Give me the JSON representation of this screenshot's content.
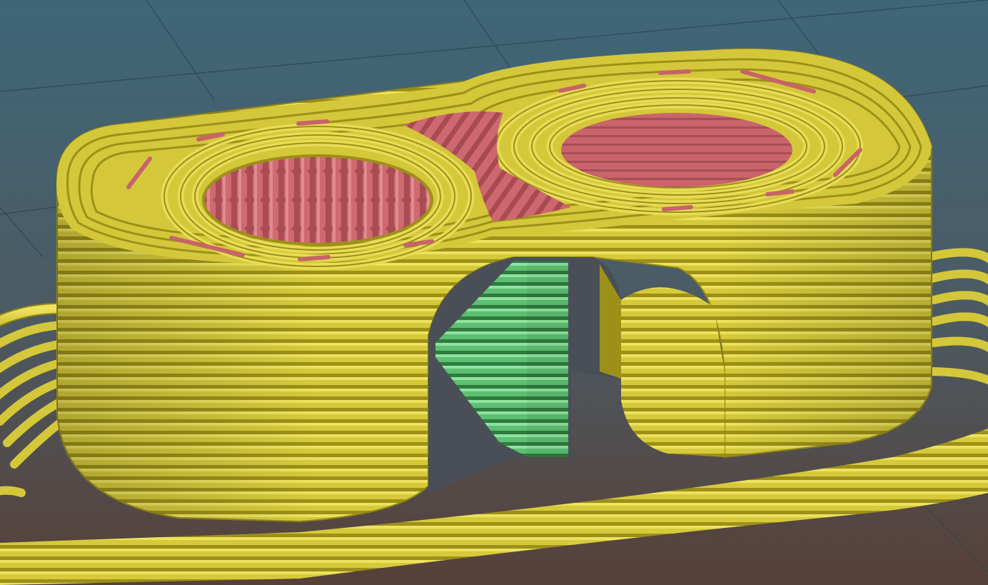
{
  "viewport": {
    "kind": "3d-gcode-preview",
    "background_top": "#3f6678",
    "background_bottom": "#564039",
    "grid_color": "#2e4451"
  },
  "model": {
    "perimeter_color": "#d4c83a",
    "perimeter_highlight": "#ece15a",
    "perimeter_shadow": "#8f8416",
    "infill_color": "#c8636a",
    "infill_shadow": "#93434a",
    "support_color": "#5dbf71",
    "support_shadow": "#2f7a3f",
    "icons": [
      "skirt",
      "body-perimeters",
      "left-hole-infill",
      "right-hole-infill",
      "center-infill",
      "arch-opening",
      "support-column"
    ]
  }
}
